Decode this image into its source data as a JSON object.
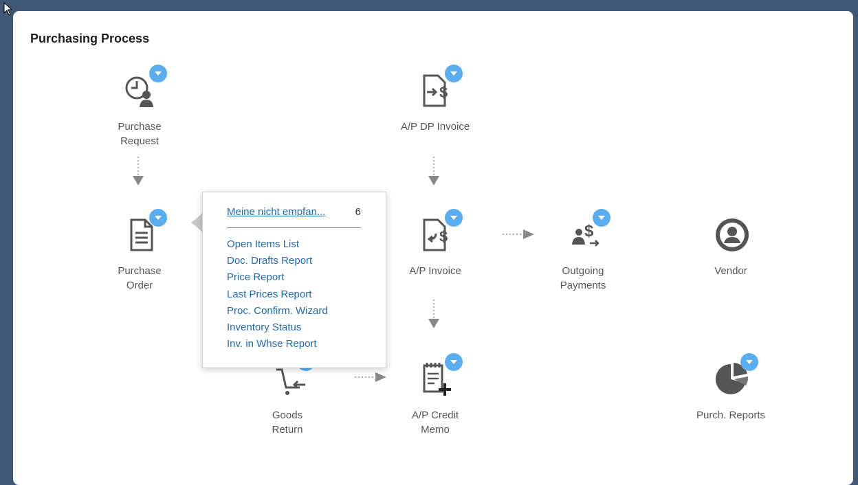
{
  "page": {
    "title": "Purchasing Process"
  },
  "nodes": {
    "purchase_request": "Purchase\nRequest",
    "purchase_order": "Purchase\nOrder",
    "goods_return": "Goods\nReturn",
    "ap_dp_invoice": "A/P DP Invoice",
    "ap_invoice": "A/P Invoice",
    "ap_credit_memo": "A/P Credit\nMemo",
    "outgoing_payments": "Outgoing\nPayments",
    "vendor": "Vendor",
    "purch_reports": "Purch. Reports"
  },
  "popup": {
    "header_link": "Meine nicht empfan...",
    "header_count": "6",
    "items": [
      "Open Items List",
      "Doc. Drafts Report",
      "Price Report",
      "Last Prices Report",
      "Proc. Confirm. Wizard",
      "Inventory Status",
      "Inv. in Whse Report"
    ]
  },
  "colors": {
    "background": "#3f5876",
    "accent": "#5aaef0",
    "link": "#1f6bb0",
    "icon": "#555555"
  },
  "icons": [
    "clock-person-icon",
    "document-icon",
    "cart-return-icon",
    "document-dollar-arrow-icon",
    "document-dollar-return-icon",
    "notepad-plus-icon",
    "people-dollar-icon",
    "person-circle-icon",
    "pie-chart-icon",
    "dropdown-chevron-icon"
  ]
}
